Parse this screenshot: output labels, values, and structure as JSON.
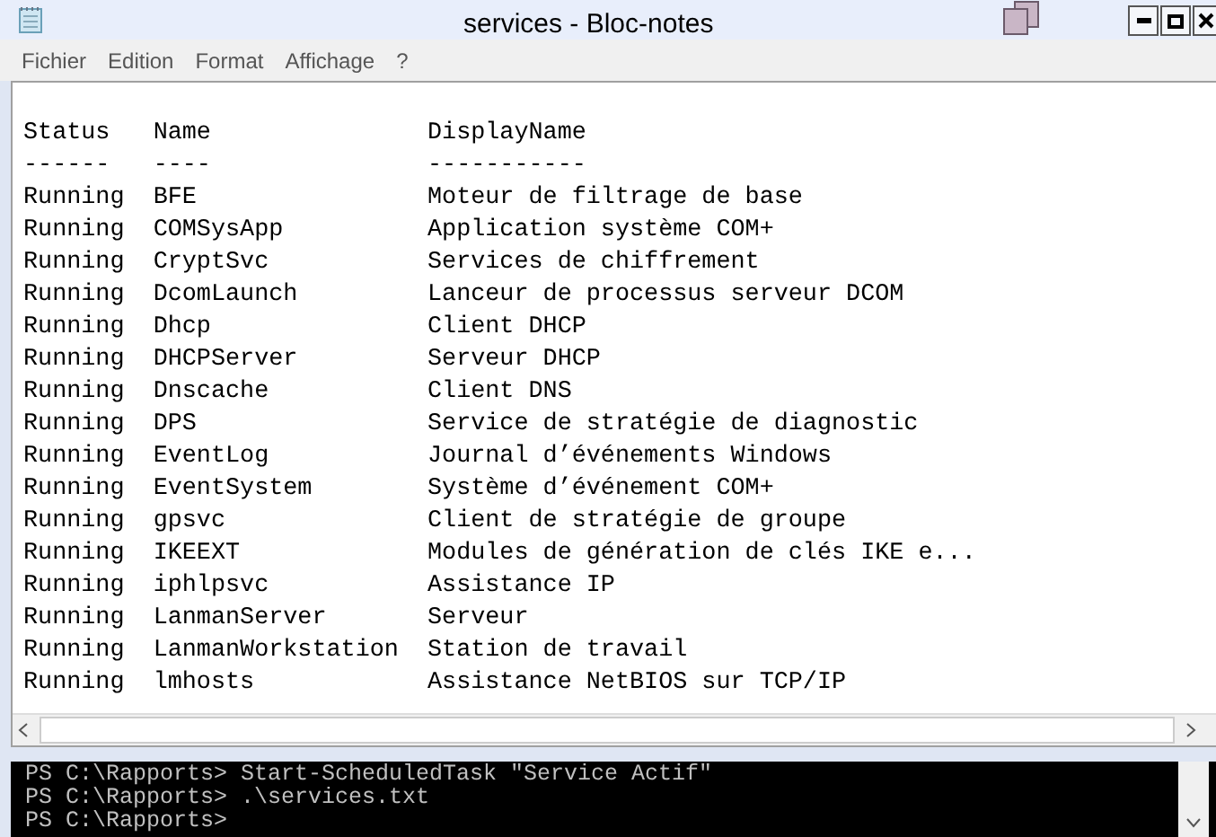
{
  "window": {
    "title": "services - Bloc-notes"
  },
  "menu": [
    "Fichier",
    "Edition",
    "Format",
    "Affichage",
    "?"
  ],
  "document": {
    "lines": [
      "Status   Name               DisplayName",
      "------   ----               -----------",
      "Running  BFE                Moteur de filtrage de base",
      "Running  COMSysApp          Application système COM+",
      "Running  CryptSvc           Services de chiffrement",
      "Running  DcomLaunch         Lanceur de processus serveur DCOM",
      "Running  Dhcp               Client DHCP",
      "Running  DHCPServer         Serveur DHCP",
      "Running  Dnscache           Client DNS",
      "Running  DPS                Service de stratégie de diagnostic",
      "Running  EventLog           Journal d’événements Windows",
      "Running  EventSystem        Système d’événement COM+",
      "Running  gpsvc              Client de stratégie de groupe",
      "Running  IKEEXT             Modules de génération de clés IKE e...",
      "Running  iphlpsvc           Assistance IP",
      "Running  LanmanServer       Serveur",
      "Running  LanmanWorkstation  Station de travail",
      "Running  lmhosts            Assistance NetBIOS sur TCP/IP"
    ]
  },
  "console": {
    "lines": [
      "PS C:\\Rapports> Start-ScheduledTask \"Service Actif\"",
      "PS C:\\Rapports> .\\services.txt",
      "PS C:\\Rapports>"
    ]
  }
}
